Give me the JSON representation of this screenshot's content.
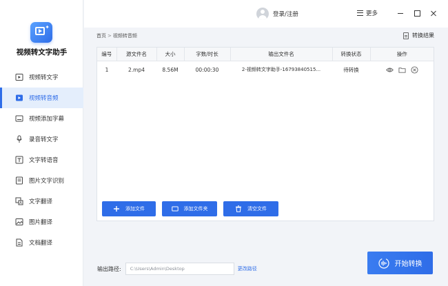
{
  "app": {
    "name": "视频转文字助手"
  },
  "sidebar": {
    "items": [
      {
        "label": "视频转文字",
        "icon": "video-to-text-icon"
      },
      {
        "label": "视频转音频",
        "icon": "video-to-audio-icon",
        "active": true
      },
      {
        "label": "视频添加字幕",
        "icon": "subtitle-icon"
      },
      {
        "label": "录音转文字",
        "icon": "recording-icon"
      },
      {
        "label": "文字转语音",
        "icon": "text-to-speech-icon"
      },
      {
        "label": "图片文字识别",
        "icon": "ocr-icon"
      },
      {
        "label": "文字翻译",
        "icon": "text-translate-icon"
      },
      {
        "label": "图片翻译",
        "icon": "image-translate-icon"
      },
      {
        "label": "文档翻译",
        "icon": "document-translate-icon"
      }
    ]
  },
  "topbar": {
    "login_label": "登录/注册",
    "more_label": "更多"
  },
  "breadcrumb": {
    "home": "首页",
    "separator": ">",
    "current": "视频转音频"
  },
  "result_link": "转换结果",
  "table": {
    "columns": [
      "编号",
      "源文件名",
      "大小",
      "字数/时长",
      "输出文件名",
      "转换状态",
      "操作"
    ],
    "rows": [
      {
        "index": "1",
        "source": "2.mp4",
        "size": "8.56M",
        "duration": "00:00:30",
        "output": "2-视频转文字助手-16793840515...",
        "status": "待转换"
      }
    ]
  },
  "buttons": {
    "add_file": "添加文件",
    "add_folder": "添加文件夹",
    "clear_files": "清空文件",
    "start": "开始转换"
  },
  "output_path": {
    "label": "输出路径:",
    "value": "C:\\Users\\Admin\\Desktop",
    "change_label": "更改路径"
  },
  "colors": {
    "accent": "#2f6de8",
    "active_bg": "#e4eefc"
  }
}
